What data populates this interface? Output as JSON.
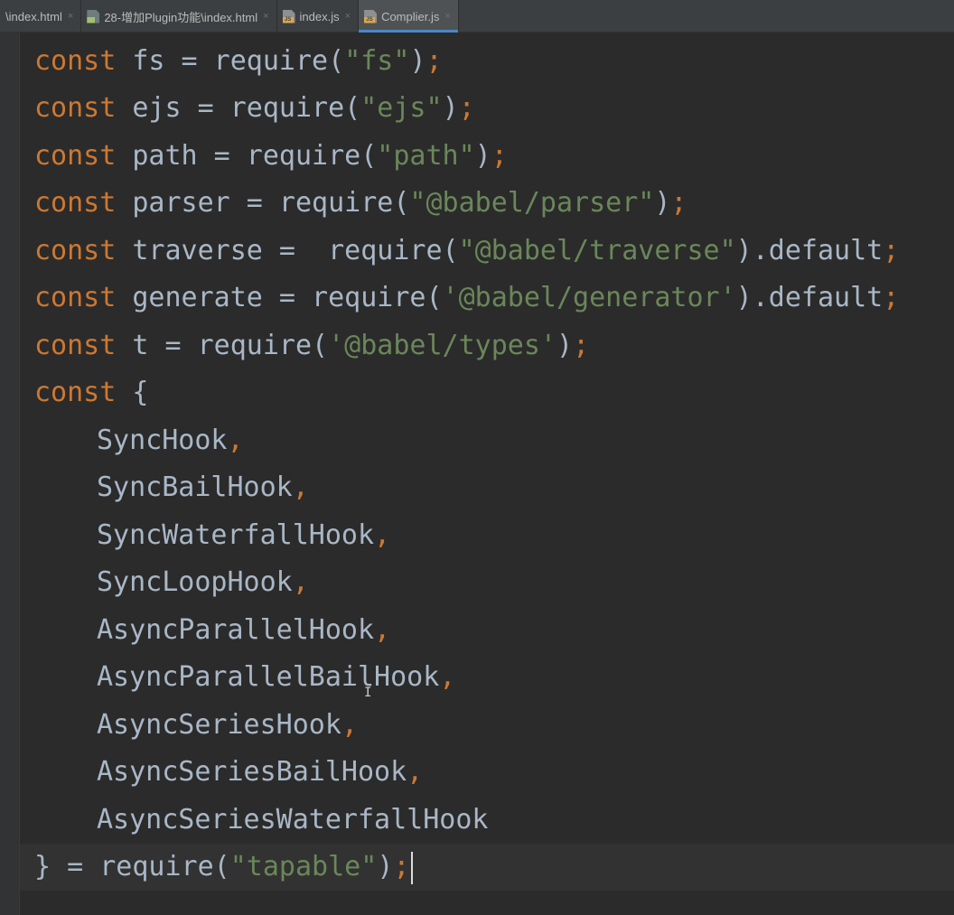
{
  "tabs": [
    {
      "label": "\\index.html",
      "icon": "none",
      "active": false
    },
    {
      "label": "28-增加Plugin功能\\index.html",
      "icon": "html-file-icon",
      "active": false
    },
    {
      "label": "index.js",
      "icon": "js-file-icon",
      "active": false
    },
    {
      "label": "Complier.js",
      "icon": "js-file-icon",
      "active": true
    }
  ],
  "close_glyph": "×",
  "accent_color": "#4a88c7",
  "code": {
    "l1": {
      "kw": "const",
      "name": " fs = require(",
      "str": "\"fs\"",
      "end": ")",
      "semi": ";"
    },
    "l2": {
      "kw": "const",
      "name": " ejs = require(",
      "str": "\"ejs\"",
      "end": ")",
      "semi": ";"
    },
    "l3": {
      "kw": "const",
      "name": " path = require(",
      "str": "\"path\"",
      "end": ")",
      "semi": ";"
    },
    "l4": {
      "kw": "const",
      "name": " parser = require(",
      "str": "\"@babel/parser\"",
      "end": ")",
      "semi": ";"
    },
    "l5": {
      "kw": "const",
      "name": " traverse =  require(",
      "str": "\"@babel/traverse\"",
      "end": ").default",
      "semi": ";"
    },
    "l6": {
      "kw": "const",
      "name": " generate = require(",
      "str": "'@babel/generator'",
      "end": ").default",
      "semi": ";"
    },
    "l7": {
      "kw": "const",
      "name": " t = require(",
      "str": "'@babel/types'",
      "end": ")",
      "semi": ";"
    },
    "l8": {
      "kw": "const",
      "rest": " {"
    },
    "hooks": [
      {
        "name": "SyncHook",
        "comma": ","
      },
      {
        "name": "SyncBailHook",
        "comma": ","
      },
      {
        "name": "SyncWaterfallHook",
        "comma": ","
      },
      {
        "name": "SyncLoopHook",
        "comma": ","
      },
      {
        "name": "AsyncParallelHook",
        "comma": ","
      },
      {
        "name": "AsyncParallelBailHook",
        "comma": ","
      },
      {
        "name": "AsyncSeriesHook",
        "comma": ","
      },
      {
        "name": "AsyncSeriesBailHook",
        "comma": ","
      },
      {
        "name": "AsyncSeriesWaterfallHook",
        "comma": ""
      }
    ],
    "last": {
      "start": "} = require(",
      "str": "\"tapable\"",
      "end": ")",
      "semi": ";"
    }
  }
}
